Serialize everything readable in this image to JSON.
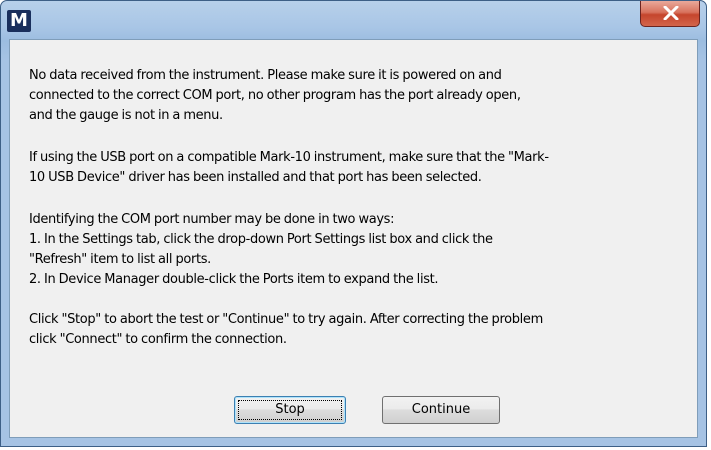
{
  "window": {
    "app_icon_letter": "M",
    "title": ""
  },
  "icons": {
    "app": "mark-10-logo-icon",
    "close": "close-icon"
  },
  "message": {
    "paragraph1": [
      "No data received from the instrument. Please make sure it is powered on and",
      "connected to the correct COM port, no other program has the port already open,",
      "and the gauge is not in a menu."
    ],
    "paragraph2": [
      "If using the USB port on a compatible Mark-10 instrument, make sure that the \"Mark-",
      "10 USB Device\" driver has been installed and that port has been selected."
    ],
    "paragraph3": [
      "Identifying the COM port number may be done in two ways:",
      "1. In the Settings tab, click the drop-down Port Settings list box and click the",
      "\"Refresh\" item to list all ports.",
      "2. In Device Manager double-click the Ports item to expand the list."
    ],
    "paragraph4": [
      "Click \"Stop\" to abort the test or \"Continue\" to try again. After correcting the problem",
      "click \"Connect\" to confirm the connection."
    ]
  },
  "buttons": {
    "stop_label": "Stop",
    "continue_label": "Continue"
  },
  "colors": {
    "frame": "#a6c3e4",
    "close_button": "#c5452d",
    "client_background": "#f0f0f0",
    "focus_border": "#3c7fb1"
  }
}
